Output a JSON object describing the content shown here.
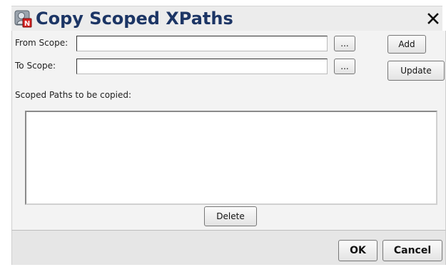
{
  "window": {
    "title": "Copy Scoped XPaths",
    "icon": "app-icon",
    "close_icon": "close-icon"
  },
  "form": {
    "from_scope_label": "From Scope:",
    "from_scope_value": "",
    "to_scope_label": "To Scope:",
    "to_scope_value": "",
    "browse_label": "...",
    "add_label": "Add",
    "update_label": "Update",
    "scoped_paths_label": "Scoped Paths to be copied:",
    "scoped_paths_items": [],
    "delete_label": "Delete"
  },
  "footer": {
    "ok_label": "OK",
    "cancel_label": "Cancel"
  },
  "colors": {
    "title_text": "#1c3565",
    "content_bg": "#f3f3f3",
    "footer_bg": "#e6e6e6"
  }
}
